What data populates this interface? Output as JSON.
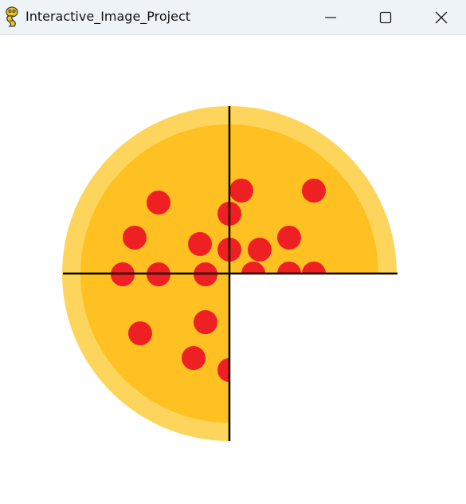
{
  "window": {
    "title": "Interactive_Image_Project",
    "app_icon": "python-snake-icon",
    "controls": {
      "minimize_icon": "minimize-icon",
      "maximize_icon": "maximize-icon",
      "close_icon": "close-icon"
    }
  },
  "pizza": {
    "quadrants_present": [
      "top-left",
      "top-right",
      "bottom-left"
    ],
    "quadrants_missing": [
      "bottom-right"
    ],
    "colors": {
      "crust": "#fed55c",
      "cheese": "#ffc021",
      "pepperoni": "#ee2024",
      "cut_line": "#000000"
    }
  }
}
